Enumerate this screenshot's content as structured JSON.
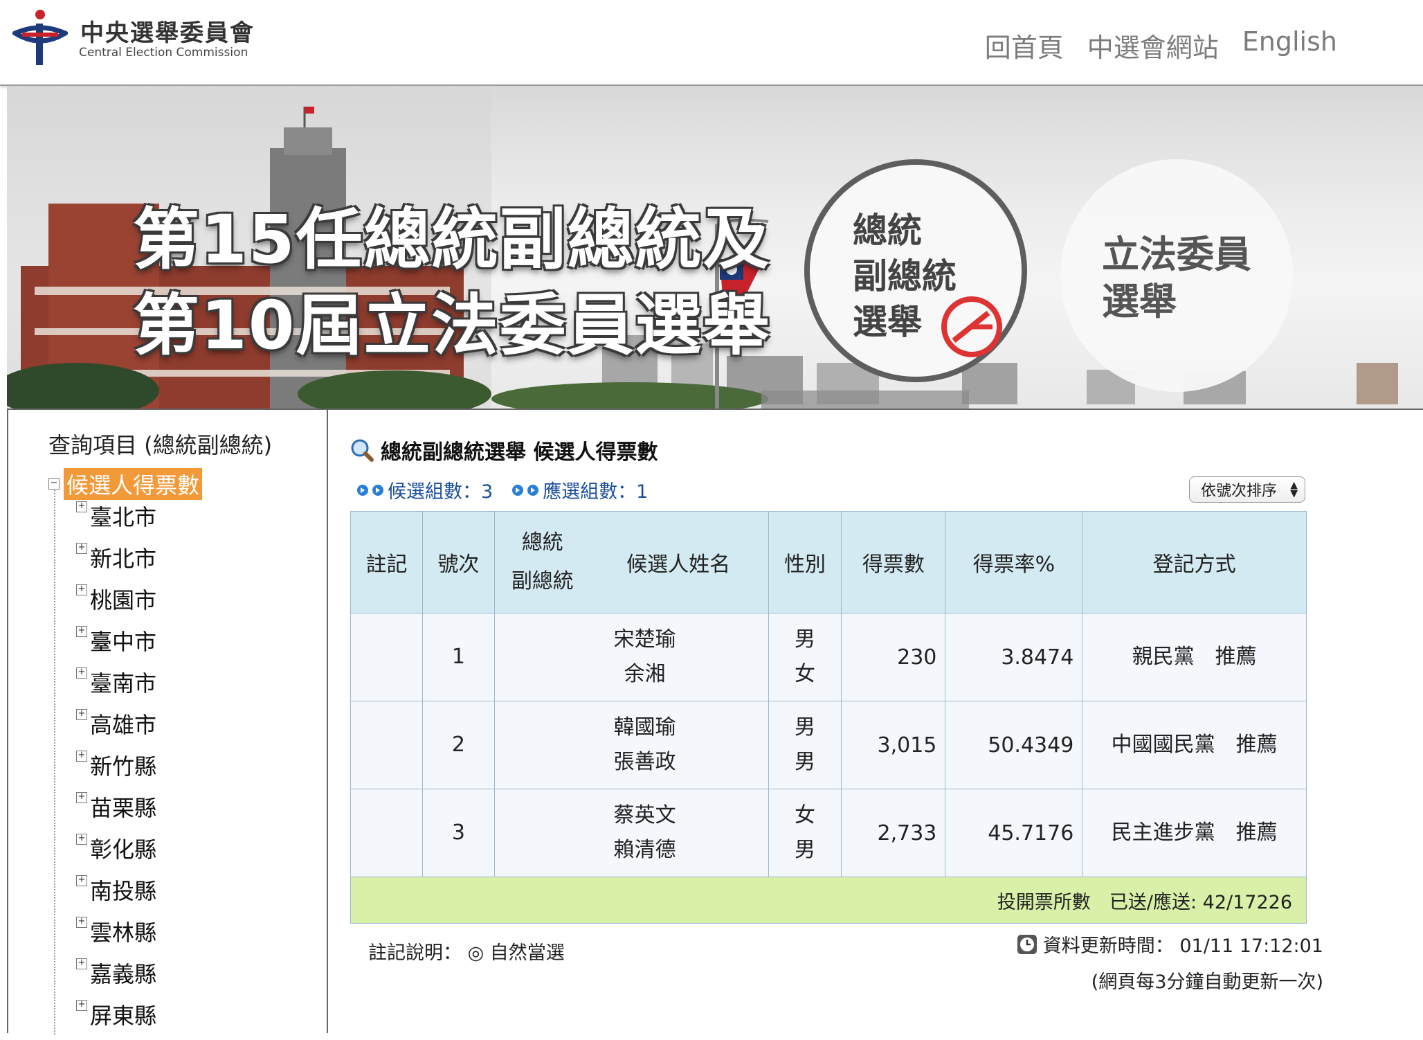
{
  "header": {
    "org_name_zh": "中央選舉委員會",
    "org_name_en": "Central Election Commission",
    "nav": [
      "回首頁",
      "中選會網站",
      "English"
    ]
  },
  "banner": {
    "title_line1": "第15任總統副總統及",
    "title_line2": "第10屆立法委員選舉",
    "presidential_btn": [
      "總統",
      "副總統",
      "選舉"
    ],
    "legislative_btn": [
      "立法委員",
      "選舉"
    ]
  },
  "sidebar": {
    "title": "查詢項目 (總統副總統)",
    "root_label": "候選人得票數",
    "cities": [
      "臺北市",
      "新北市",
      "桃園市",
      "臺中市",
      "臺南市",
      "高雄市",
      "新竹縣",
      "苗栗縣",
      "彰化縣",
      "南投縣",
      "雲林縣",
      "嘉義縣",
      "屏東縣"
    ]
  },
  "main": {
    "page_title": "總統副總統選舉 候選人得票數",
    "candidate_count": "候選組數：3",
    "elected_count": "應選組數：1",
    "sort_select": "依號次排序",
    "table": {
      "headers": {
        "note": "註記",
        "number": "號次",
        "role_line1": "總統",
        "role_line2": "副總統",
        "name": "候選人姓名",
        "gender": "性別",
        "votes": "得票數",
        "rate": "得票率%",
        "registration": "登記方式"
      },
      "rows": [
        {
          "note": "",
          "number": "1",
          "name1": "宋楚瑜",
          "name2": "余湘",
          "gender1": "男",
          "gender2": "女",
          "votes": "230",
          "rate": "3.8474",
          "registration": "親民黨　推薦"
        },
        {
          "note": "",
          "number": "2",
          "name1": "韓國瑜",
          "name2": "張善政",
          "gender1": "男",
          "gender2": "男",
          "votes": "3,015",
          "rate": "50.4349",
          "registration": "中國國民黨　推薦"
        },
        {
          "note": "",
          "number": "3",
          "name1": "蔡英文",
          "name2": "賴清德",
          "gender1": "女",
          "gender2": "男",
          "votes": "2,733",
          "rate": "45.7176",
          "registration": "民主進步黨　推薦"
        }
      ],
      "footer": "投開票所數　已送/應送: 42/17226"
    },
    "note": "註記說明：  ◎ 自然當選",
    "update_time": "資料更新時間： 01/11 17:12:01",
    "auto_refresh": "(網頁每3分鐘自動更新一次)"
  },
  "colors": {
    "sidebar_highlight": "#f29a3a",
    "table_header": "#d4eaf2",
    "table_footer": "#d8f0a8",
    "link_blue": "#1a4e9c"
  }
}
